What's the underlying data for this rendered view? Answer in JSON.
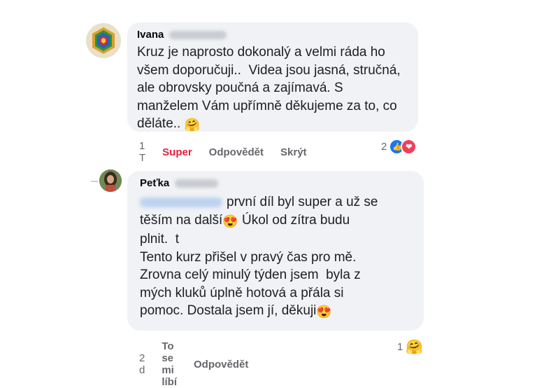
{
  "comments": [
    {
      "author": "Ivana",
      "text": "Kruz je naprosto dokonalý a velmi ráda ho\nvšem doporučuji..  Videa jsou jasná, stručná,\nale obrovsky poučná a zajímavá. S\nmanželem Vám upřímně děkujeme za to, co\nděláte.. ",
      "emoji_end": "🤗",
      "time": "1 T",
      "like_label": "Super",
      "reply_label": "Odpovědět",
      "hide_label": "Skrýt",
      "reaction_count": "2",
      "reaction_colors": {
        "like": "#1877f2",
        "love": "#f33e58"
      }
    },
    {
      "author": "Peťka",
      "line1": "první díl byl super a už se",
      "line2_pre": "těším na další",
      "line2_emoji": "😍",
      "line2_post": " Úkol od zítra budu",
      "rest": "plnit.  t\nTento kurz přišel v pravý čas pro mě.\nZrovna celý minulý týden jsem  byla z\nmých kluků úplně hotová a přála si\npomoc. Dostala jsem jí, děkuji",
      "end_emoji": "😍",
      "time": "2 d",
      "like_label": "To se mi líbí",
      "reply_label": "Odpovědět",
      "reaction_count": "1",
      "reaction_emoji": "🤗"
    }
  ]
}
